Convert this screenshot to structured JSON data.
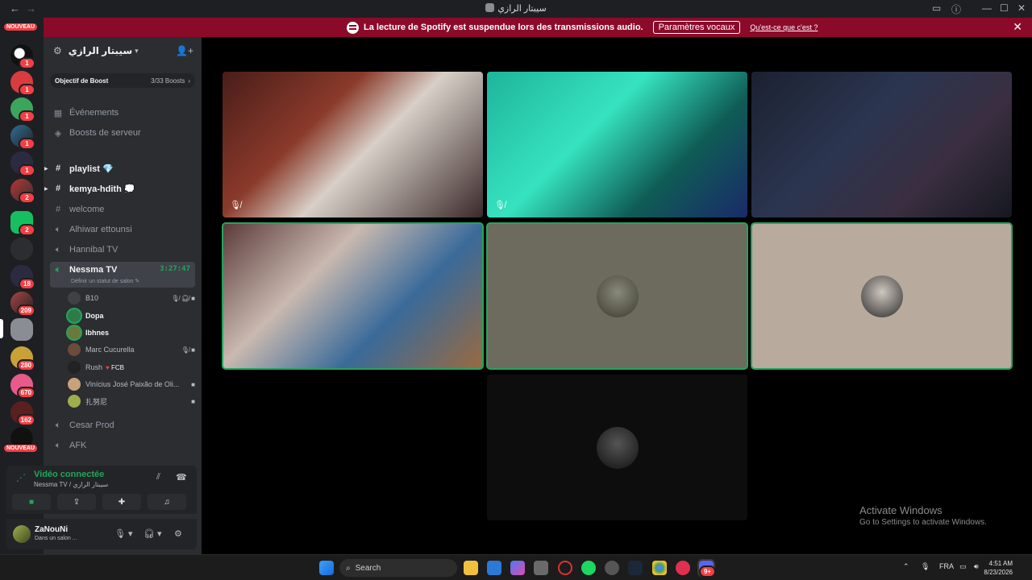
{
  "window": {
    "title": "سيبتار الرازي"
  },
  "notice": {
    "text": "La lecture de Spotify est suspendue lors des transmissions audio.",
    "button": "Paramètres vocaux",
    "link": "Qu'est-ce que c'est ?"
  },
  "rail": {
    "nouveau_top": "NOUVEAU",
    "nouveau_bottom": "NOUVEAU",
    "badges": [
      "1",
      "1",
      "1",
      "1",
      "1",
      "2",
      "2",
      "18",
      "209",
      "280",
      "670",
      "162"
    ]
  },
  "server": {
    "name": "سيبتار الرازي",
    "boost_goal": "Objectif de Boost",
    "boost_count": "3/33 Boosts",
    "channels": [
      {
        "label": "Événements",
        "icon": "calendar-icon"
      },
      {
        "label": "Boosts de serveur",
        "icon": "boost-icon"
      },
      {
        "label": "playlist 💎",
        "icon": "hash-icon"
      },
      {
        "label": "kemya-hdith 💭",
        "icon": "hash-icon"
      },
      {
        "label": "welcome",
        "icon": "hash-icon"
      },
      {
        "label": "Alhiwar ettounsi",
        "icon": "speaker-icon"
      },
      {
        "label": "Hannibal TV",
        "icon": "speaker-icon"
      }
    ],
    "active_channel": {
      "label": "Nessma TV",
      "time": "3:27:47",
      "status": "Définir un statut de salon"
    },
    "members": [
      {
        "name": "B10"
      },
      {
        "name": "Dopa"
      },
      {
        "name": "Ibhnes"
      },
      {
        "name": "Marc Cucurella"
      },
      {
        "name": "Rush",
        "tag": "FCB"
      },
      {
        "name": "Vinícius José Paixão de Oli..."
      },
      {
        "name": "扎努尼"
      }
    ],
    "after_channels": [
      {
        "label": "Cesar Prod"
      },
      {
        "label": "AFK"
      }
    ]
  },
  "voice": {
    "status": "Vidéo connectée",
    "location": "Nessma TV / سيبتار الرازي"
  },
  "user": {
    "name": "ZaNouNi",
    "status": "Dans un salon ..."
  },
  "watermark": {
    "line1": "Activate Windows",
    "line2": "Go to Settings to activate Windows."
  },
  "taskbar": {
    "search": "Search",
    "lang": "FRA",
    "time": "4:51 AM",
    "date": "8/23/2026",
    "discord_badge": "9+"
  },
  "colors": {
    "accent_green": "#23a55a",
    "notice_bg": "#8b0a2a",
    "sidebar_bg": "#2b2d31",
    "rail_bg": "#1e1f22"
  }
}
